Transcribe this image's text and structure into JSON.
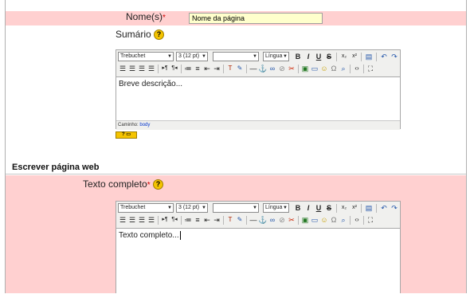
{
  "form": {
    "name_label": "Nome(s)",
    "name_required": "*",
    "name_value": "Nome da página",
    "summary_label": "Sumário",
    "help_glyph": "?",
    "section_title": "Escrever página web",
    "fulltext_label": "Texto completo",
    "fulltext_required": "*"
  },
  "editor_toolbar": {
    "font": "Trebuchet",
    "size": "3 (12 pt)",
    "format": "",
    "language": "Língua",
    "bold": "B",
    "italic": "I",
    "underline": "U",
    "strike": "S"
  },
  "editor1": {
    "content": "Breve descrição...",
    "path_label": "Caminho:",
    "path_value": "body",
    "help_badge": "? ▭"
  },
  "editor2": {
    "content": "Texto completo..."
  },
  "colors": {
    "pink": "#ffd0d0",
    "input_yellow": "#ffffcc",
    "help_yellow": "#f5c400"
  }
}
